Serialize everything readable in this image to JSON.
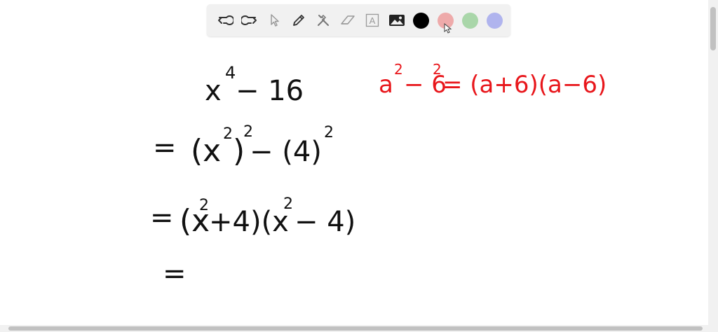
{
  "toolbar": {
    "tools": [
      {
        "name": "undo",
        "icon": "undo-icon"
      },
      {
        "name": "redo",
        "icon": "redo-icon"
      },
      {
        "name": "select",
        "icon": "pointer-icon"
      },
      {
        "name": "pen",
        "icon": "pencil-icon"
      },
      {
        "name": "tools",
        "icon": "tools-icon"
      },
      {
        "name": "eraser",
        "icon": "eraser-icon"
      },
      {
        "name": "text",
        "icon": "text-box-icon",
        "glyph": "A"
      },
      {
        "name": "image",
        "icon": "image-icon"
      }
    ],
    "colors": [
      {
        "name": "black",
        "hex": "#000000"
      },
      {
        "name": "red",
        "hex": "#eeaaaa"
      },
      {
        "name": "green",
        "hex": "#a9d6a9"
      },
      {
        "name": "blue",
        "hex": "#b0b4ee"
      }
    ]
  },
  "board": {
    "ink_color": "#111111",
    "accent_color": "#e8161b",
    "line1": {
      "base": "x",
      "exp": "4",
      "rest": " − 16"
    },
    "line2": {
      "eq": "=",
      "text": "(x",
      "exp1": "2",
      "mid": ")",
      "exp2": "2",
      "minus": " − (4)",
      "exp3": "2"
    },
    "line3": {
      "eq": "=",
      "p1": "(x",
      "exp1": "2",
      "p1b": "+4)(x",
      "exp2": "2",
      "p2": " − 4)"
    },
    "line4": {
      "eq": "="
    },
    "identity": {
      "a": "a",
      "exp1": "2",
      "minus": "− 6",
      "exp2": "2",
      "rest": " = (a+6)(a−6)"
    }
  }
}
